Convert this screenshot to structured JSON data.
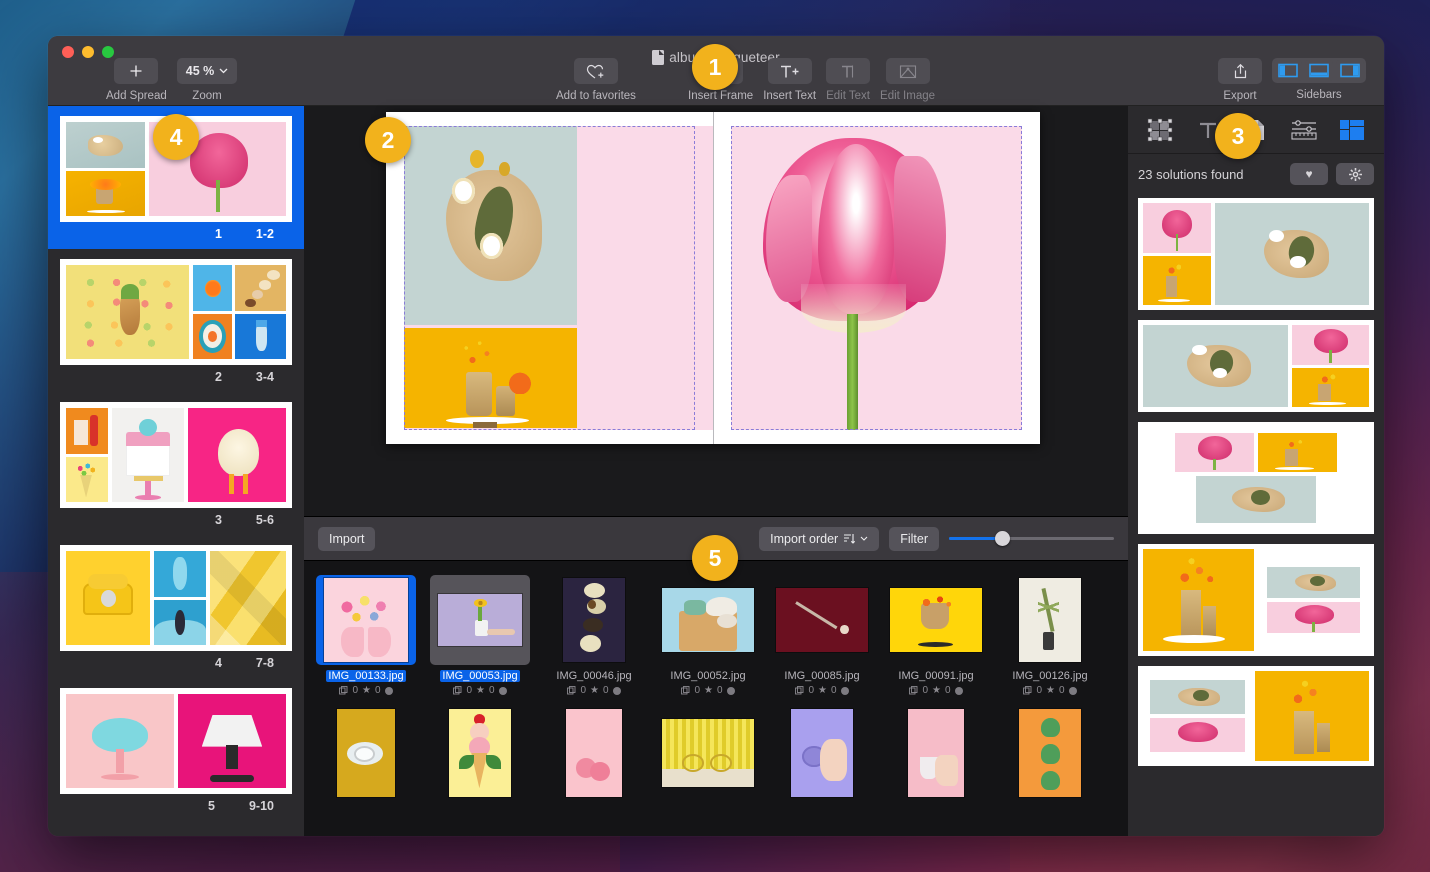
{
  "window": {
    "title": "album bouqueteer",
    "title_icon": "document-icon",
    "traffic_lights": [
      "close",
      "minimize",
      "zoom"
    ]
  },
  "toolbar": {
    "add_spread": {
      "label": "Add Spread",
      "icon": "plus-icon"
    },
    "zoom": {
      "label": "Zoom",
      "value": "45 %",
      "icon": "chevron-down-icon"
    },
    "add_to_favorites": {
      "label": "Add to favorites",
      "icon": "heart-plus-icon"
    },
    "insert_frame": {
      "label": "Insert Frame",
      "icon": "frame-plus-icon"
    },
    "insert_text": {
      "label": "Insert Text",
      "icon": "text-plus-icon"
    },
    "edit_text": {
      "label": "Edit Text",
      "icon": "text-cursor-icon"
    },
    "edit_image": {
      "label": "Edit Image",
      "icon": "image-edit-icon"
    },
    "export": {
      "label": "Export",
      "icon": "share-up-icon"
    },
    "sidebars": {
      "label": "Sidebars",
      "buttons": [
        "left-sidebar-icon",
        "bottom-bar-icon",
        "right-sidebar-icon"
      ]
    }
  },
  "spreads": [
    {
      "number": "1",
      "pages": "1-2",
      "selected": true
    },
    {
      "number": "2",
      "pages": "3-4",
      "selected": false
    },
    {
      "number": "3",
      "pages": "5-6",
      "selected": false
    },
    {
      "number": "4",
      "pages": "7-8",
      "selected": false
    },
    {
      "number": "5",
      "pages": "9-10",
      "selected": false
    }
  ],
  "browser": {
    "import_label": "Import",
    "sort_label": "Import order",
    "sort_icon": "sort-descending-icon",
    "sort_chevron": "chevron-down-icon",
    "filter_label": "Filter",
    "zoom_slider_value": 28,
    "row1": [
      {
        "file": "IMG_00133.jpg",
        "copies": "0",
        "stars": "0",
        "selected": true
      },
      {
        "file": "IMG_00053.jpg",
        "copies": "0",
        "stars": "0",
        "selected": true
      },
      {
        "file": "IMG_00046.jpg",
        "copies": "0",
        "stars": "0",
        "selected": false
      },
      {
        "file": "IMG_00052.jpg",
        "copies": "0",
        "stars": "0",
        "selected": false
      },
      {
        "file": "IMG_00085.jpg",
        "copies": "0",
        "stars": "0",
        "selected": false
      },
      {
        "file": "IMG_00091.jpg",
        "copies": "0",
        "stars": "0",
        "selected": false
      },
      {
        "file": "IMG_00126.jpg",
        "copies": "0",
        "stars": "0",
        "selected": false
      }
    ]
  },
  "inspector": {
    "tabs": [
      {
        "name": "frame-inspector-tab",
        "icon": "frame-nodes-icon",
        "active": false
      },
      {
        "name": "text-inspector-tab",
        "icon": "text-T-icon",
        "active": false
      },
      {
        "name": "document-inspector-tab",
        "icon": "page-icon",
        "active": false
      },
      {
        "name": "adjust-inspector-tab",
        "icon": "sliders-ruler-icon",
        "active": false
      },
      {
        "name": "layout-inspector-tab",
        "icon": "layout-grid-icon",
        "active": true
      }
    ],
    "solutions_found": "23 solutions found",
    "favorite_icon": "heart-icon",
    "settings_icon": "gear-icon"
  },
  "callouts": [
    {
      "id": "1",
      "target": "insert-frame-toolbar"
    },
    {
      "id": "2",
      "target": "canvas-spread"
    },
    {
      "id": "3",
      "target": "layout-inspector"
    },
    {
      "id": "4",
      "target": "selected-spread"
    },
    {
      "id": "5",
      "target": "image-browser"
    }
  ],
  "colors": {
    "accent_blue": "#0a63e8",
    "badge_gold": "#f2b21c",
    "toolbar_bg": "#3d3b40",
    "panel_bg": "#2b2a2d",
    "canvas_bg": "#1a1a1c",
    "guide_purple": "#8a7bd8"
  }
}
